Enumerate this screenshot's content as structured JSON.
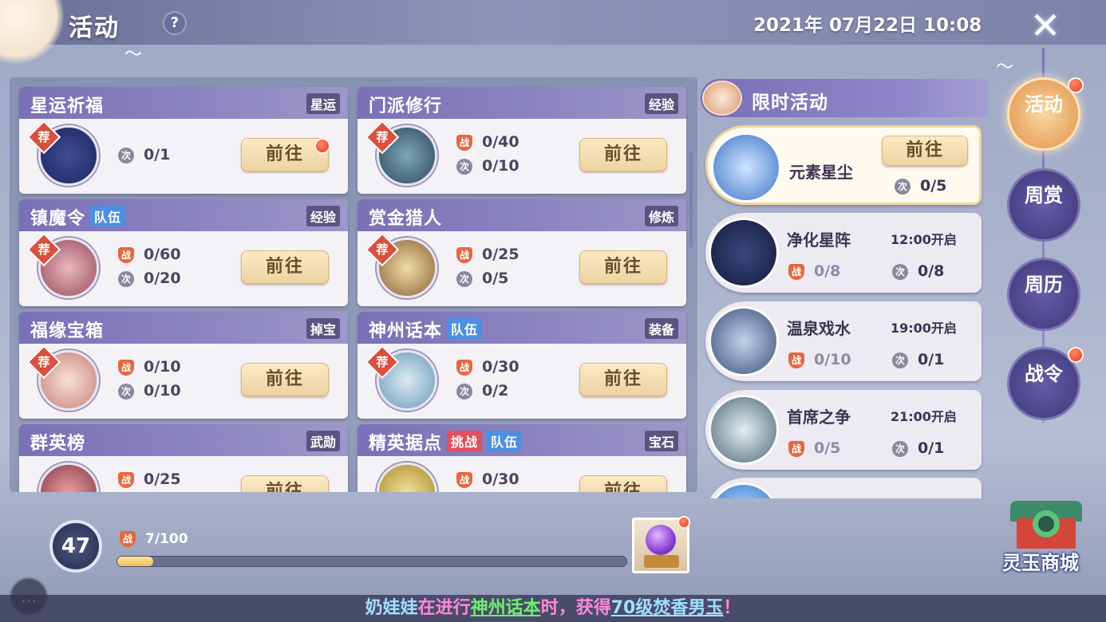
{
  "header": {
    "title": "活动",
    "help_label": "?",
    "datetime": "2021年 07月22日 10:08",
    "close_label": "✕"
  },
  "activities": [
    {
      "name": "星运祈福",
      "tags": [],
      "type": "星运",
      "recommended": true,
      "rec_label": "荐",
      "battle": null,
      "count": "0/1",
      "button": "前往",
      "red_dot": true,
      "icon": "star-constellation-icon"
    },
    {
      "name": "门派修行",
      "tags": [],
      "type": "经验",
      "recommended": true,
      "rec_label": "荐",
      "battle": "0/40",
      "count": "0/10",
      "button": "前往",
      "red_dot": false,
      "icon": "sect-master-icon"
    },
    {
      "name": "镇魔令",
      "tags": [
        {
          "label": "队伍",
          "color": "blue"
        }
      ],
      "type": "经验",
      "recommended": true,
      "rec_label": "荐",
      "battle": "0/60",
      "count": "0/20",
      "button": "前往",
      "red_dot": false,
      "icon": "demon-icon"
    },
    {
      "name": "赏金猎人",
      "tags": [],
      "type": "修炼",
      "recommended": true,
      "rec_label": "荐",
      "battle": "0/25",
      "count": "0/5",
      "button": "前往",
      "red_dot": false,
      "icon": "bounty-board-icon"
    },
    {
      "name": "福缘宝箱",
      "tags": [],
      "type": "掉宝",
      "recommended": true,
      "rec_label": "荐",
      "battle": "0/10",
      "count": "0/10",
      "button": "前往",
      "red_dot": false,
      "icon": "mask-icon"
    },
    {
      "name": "神州话本",
      "tags": [
        {
          "label": "队伍",
          "color": "blue"
        }
      ],
      "type": "装备",
      "recommended": true,
      "rec_label": "荐",
      "battle": "0/30",
      "count": "0/2",
      "button": "前往",
      "red_dot": false,
      "icon": "dragon-icon"
    },
    {
      "name": "群英榜",
      "tags": [],
      "type": "武勋",
      "recommended": false,
      "rec_label": "",
      "battle": "0/25",
      "count": "",
      "button": "前往",
      "red_dot": false,
      "icon": "hero-icon"
    },
    {
      "name": "精英据点",
      "tags": [
        {
          "label": "挑战",
          "color": "red"
        },
        {
          "label": "队伍",
          "color": "blue"
        }
      ],
      "type": "宝石",
      "recommended": false,
      "rec_label": "",
      "battle": "0/30",
      "count": "",
      "button": "前往",
      "red_dot": false,
      "icon": "golden-beast-icon"
    }
  ],
  "stat_icons": {
    "battle": "战",
    "count": "次"
  },
  "limited": {
    "title": "限时活动",
    "items": [
      {
        "name": "元素星尘",
        "time": "",
        "battle": "",
        "count": "0/5",
        "button": "前往",
        "active": true,
        "icon": "crystal-icon"
      },
      {
        "name": "净化星阵",
        "time": "12:00开启",
        "battle": "0/8",
        "count": "0/8",
        "button": "",
        "active": false,
        "icon": "constellation-icon"
      },
      {
        "name": "温泉戏水",
        "time": "19:00开启",
        "battle": "0/10",
        "count": "0/1",
        "button": "",
        "active": false,
        "icon": "hot-spring-icon"
      },
      {
        "name": "首席之争",
        "time": "21:00开启",
        "battle": "0/5",
        "count": "0/1",
        "button": "",
        "active": false,
        "icon": "sword-duel-icon"
      }
    ]
  },
  "side_nav": [
    {
      "label": "活动",
      "active": true,
      "red_dot": true
    },
    {
      "label": "周赏",
      "active": false,
      "red_dot": false
    },
    {
      "label": "周历",
      "active": false,
      "red_dot": false
    },
    {
      "label": "战令",
      "active": false,
      "red_dot": true
    }
  ],
  "bottom": {
    "level": "47",
    "progress_label": "7/100",
    "progress_value": 0.07,
    "shop_label": "灵玉商城",
    "chat_icon": "chat-bubble-icon"
  },
  "ticker": {
    "player": "奶娃娃",
    "part1": "在进行",
    "activity": "神州话本",
    "part2": "时，获得",
    "reward": "70级焚香男玉",
    "end": "！"
  },
  "colors": {
    "accent_purple": "#7a70b6",
    "button_gold": "#eed3a2",
    "red_dot": "#e3391f",
    "tag_blue": "#4d8fe0",
    "tag_red": "#e0505e"
  }
}
